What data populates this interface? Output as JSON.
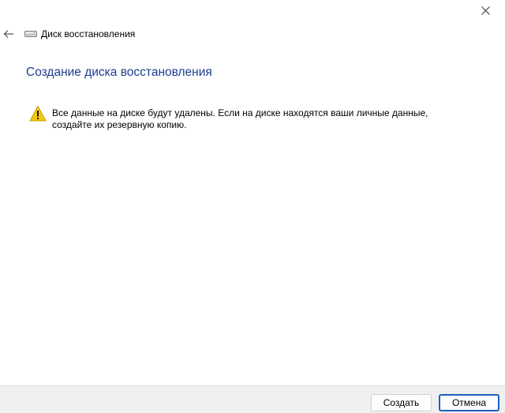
{
  "window": {
    "title": "Диск восстановления"
  },
  "page": {
    "heading": "Создание диска восстановления",
    "warning_text": "Все данные на диске будут удалены. Если на диске находятся ваши личные данные, создайте их резервную копию."
  },
  "footer": {
    "create_label": "Создать",
    "cancel_label": "Отмена"
  },
  "icons": {
    "close": "close-icon",
    "back": "back-arrow-icon",
    "drive": "drive-icon",
    "warning": "warning-icon"
  },
  "colors": {
    "heading": "#1e3d8f",
    "warning_fill": "#f2c811",
    "default_button_border": "#1f5fbf",
    "footer_background": "#f0f0f0"
  }
}
